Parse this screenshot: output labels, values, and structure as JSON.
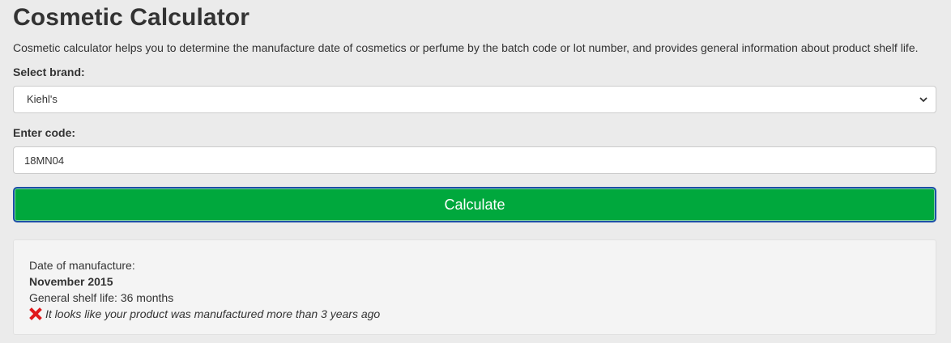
{
  "page": {
    "title": "Cosmetic Calculator",
    "intro": "Cosmetic calculator helps you to determine the manufacture date of cosmetics or perfume by the batch code or lot number, and provides general information about product shelf life."
  },
  "form": {
    "brand_label": "Select brand:",
    "brand_selected": "Kiehl's",
    "code_label": "Enter code:",
    "code_value": "18MN04",
    "calculate_label": "Calculate"
  },
  "result": {
    "date_label": "Date of manufacture:",
    "date_value": "November 2015",
    "shelf_life": "General shelf life: 36 months",
    "warning": "It looks like your product was manufactured more than 3 years ago",
    "warning_icon": "red-x-icon"
  },
  "colors": {
    "background": "#ebebeb",
    "button": "#00a83d",
    "button_border": "#1d4fa8",
    "error_icon": "#e0191c"
  }
}
